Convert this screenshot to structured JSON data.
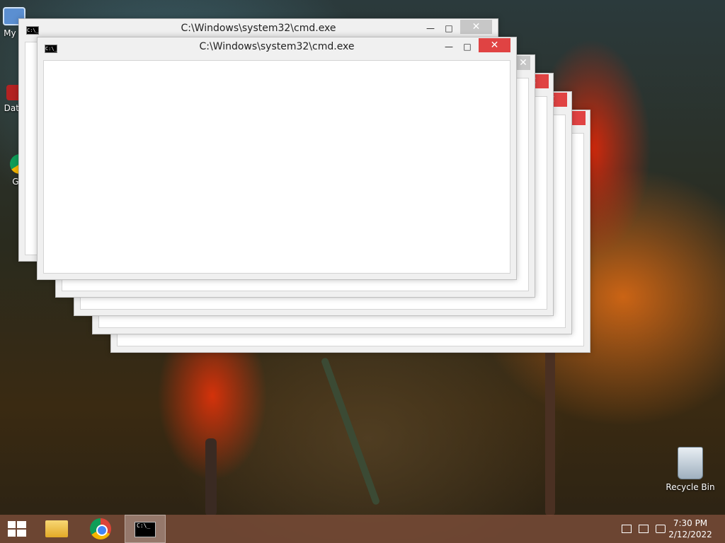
{
  "desktop": {
    "icons": [
      {
        "label": "My C"
      },
      {
        "label": "Data"
      },
      {
        "label": "G C"
      },
      {
        "label": "Recycle Bin"
      }
    ]
  },
  "windows": [
    {
      "title": "C:\\Windows\\system32\\cmd.exe",
      "min": "—",
      "max": "□",
      "close": "✕"
    },
    {
      "title": "C:\\Windows\\system32\\cmd.exe",
      "min": "—",
      "max": "□",
      "close": "✕"
    },
    {
      "title": "",
      "close": "✕"
    },
    {
      "title": "",
      "close": "✕"
    },
    {
      "title": "",
      "max": "□",
      "close": "✕"
    },
    {
      "title": "",
      "close": ""
    }
  ],
  "cmd_icon_text": "C:\\_",
  "taskbar": {
    "clock_time": "7:30 PM",
    "clock_date": "2/12/2022"
  }
}
